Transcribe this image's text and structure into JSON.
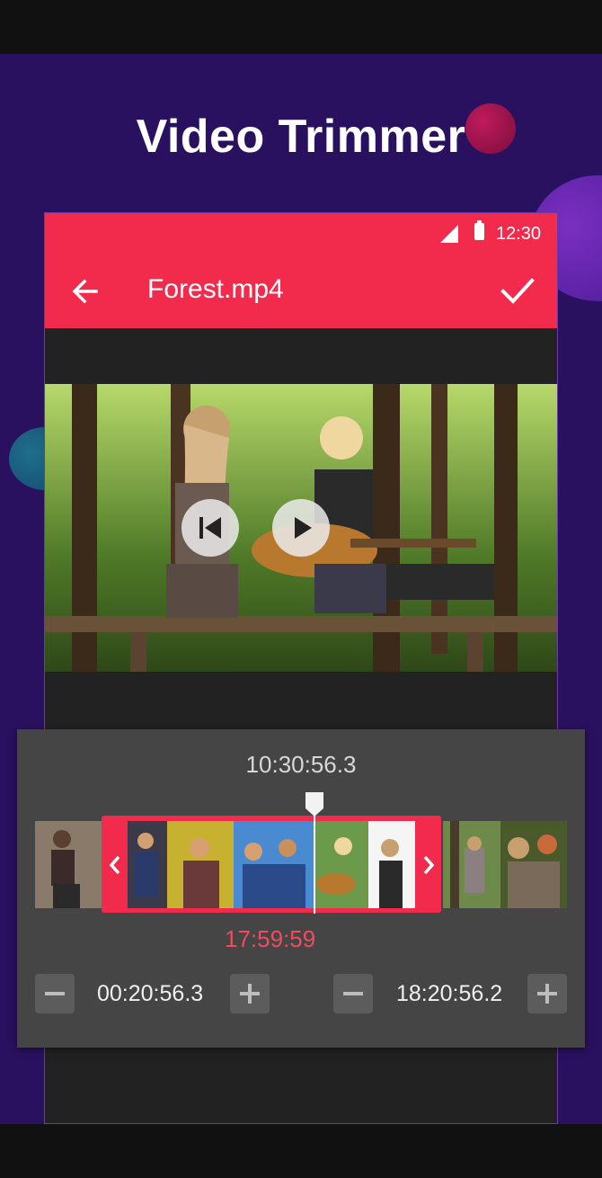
{
  "headline": "Video Trimmer",
  "status_bar": {
    "time": "12:30",
    "icons": [
      "signal-icon",
      "battery-icon"
    ]
  },
  "app_bar": {
    "title": "Forest.mp4",
    "back_icon": "arrow-left-icon",
    "confirm_icon": "check-icon"
  },
  "player": {
    "controls": [
      "skip-previous-icon",
      "play-icon"
    ]
  },
  "trim": {
    "current_time": "10:30:56.3",
    "duration": "17:59:59",
    "start_time": "00:20:56.3",
    "end_time": "18:20:56.2",
    "selection_start_fraction": 0.15,
    "selection_end_fraction": 0.77,
    "playhead_fraction": 0.53
  },
  "colors": {
    "accent": "#f22b4d",
    "promo_background": "#2a1160",
    "panel": "#454545",
    "duration_text": "#f24a5f"
  }
}
